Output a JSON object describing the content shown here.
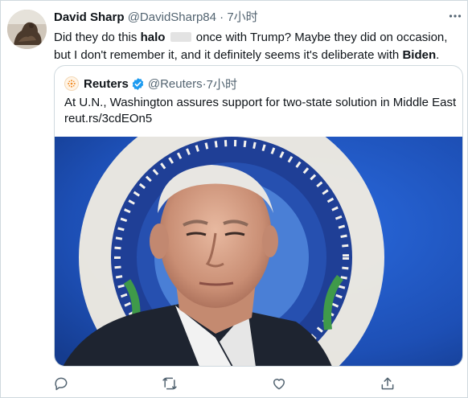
{
  "tweet": {
    "author_name": "David Sharp",
    "handle": "@DavidSharp84",
    "separator": " · ",
    "time": "7小时",
    "text_part1": "Did they do this ",
    "text_bold1": "halo",
    "text_part2": " once with Trump? Maybe they did on occasion, but I don't remember it, and it definitely seems it's deliberate with ",
    "text_bold2": "Biden",
    "text_part3": "."
  },
  "quoted": {
    "name": "Reuters",
    "handle": "@Reuters",
    "separator": " · ",
    "time": "7小时",
    "text": "At U.N., Washington assures support for two-state solution in Middle East",
    "link": "reut.rs/3cdEOn5"
  },
  "icons": {
    "more": "more-options-icon",
    "verified": "verified-badge-icon",
    "reply": "reply-icon",
    "retweet": "retweet-icon",
    "like": "like-icon",
    "share": "share-icon"
  },
  "colors": {
    "accent": "#1d9bf0",
    "text": "#0f1419",
    "secondary": "#536471",
    "border": "#cfd9de",
    "image_bg": "#1f4fb0"
  }
}
